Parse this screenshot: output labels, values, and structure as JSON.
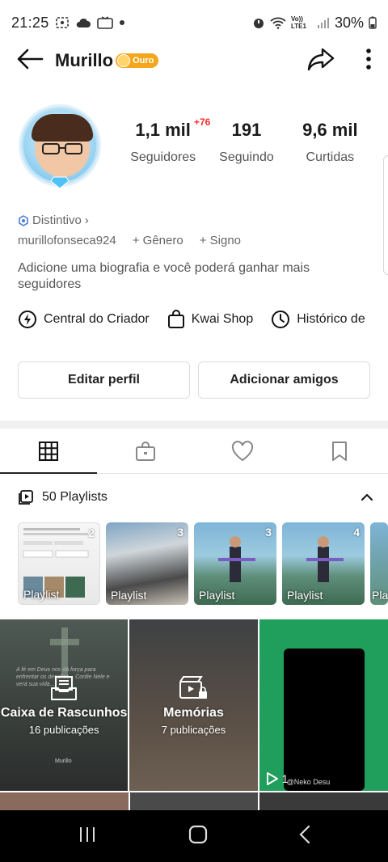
{
  "status_bar": {
    "time": "21:25",
    "network": "Vo)) LTE1",
    "battery": "30%"
  },
  "header": {
    "title": "Murillo",
    "badge": "Ouro"
  },
  "stats": {
    "new_followers": "+76",
    "followers_value": "1,1 mil",
    "followers_label": "Seguidores",
    "following_value": "191",
    "following_label": "Seguindo",
    "likes_value": "9,6 mil",
    "likes_label": "Curtidas"
  },
  "profile": {
    "distintivo": "Distintivo",
    "username": "murillofonseca924",
    "gender": "+ Gênero",
    "sign": "+ Signo",
    "bio": "Adicione uma biografia e você poderá ganhar mais seguidores"
  },
  "quick_links": {
    "creator_center": "Central do Criador",
    "kwai_shop": "Kwai Shop",
    "history": "Histórico de"
  },
  "buttons": {
    "edit_profile": "Editar perfil",
    "add_friends": "Adicionar amigos"
  },
  "tabs": [
    "grid-icon",
    "lock-bag-icon",
    "heart-icon",
    "bookmark-icon"
  ],
  "playlists": {
    "header": "50 Playlists",
    "items": [
      {
        "label": "Playlist",
        "count": "2"
      },
      {
        "label": "Playlist",
        "count": "3"
      },
      {
        "label": "Playlist",
        "count": "3"
      },
      {
        "label": "Playlist",
        "count": "4"
      },
      {
        "label": "Pla",
        "count": ""
      }
    ]
  },
  "grid": {
    "drafts_title": "Caixa de Rascunhos",
    "drafts_sub": "16 publicações",
    "memories_title": "Memórias",
    "memories_sub": "7 publicações",
    "video_plays": "1",
    "video_watermark": "@Neko Desu",
    "post_bg_text": "A fé em Deus nos dá força para enfrentar os desafios... Confie Nele e verá sua vida...",
    "post_author": "Murillo"
  },
  "colors": {
    "accent_gold": "#f4a71d",
    "new_badge": "#ff2d2d",
    "green_cell": "#1f9e5c"
  }
}
